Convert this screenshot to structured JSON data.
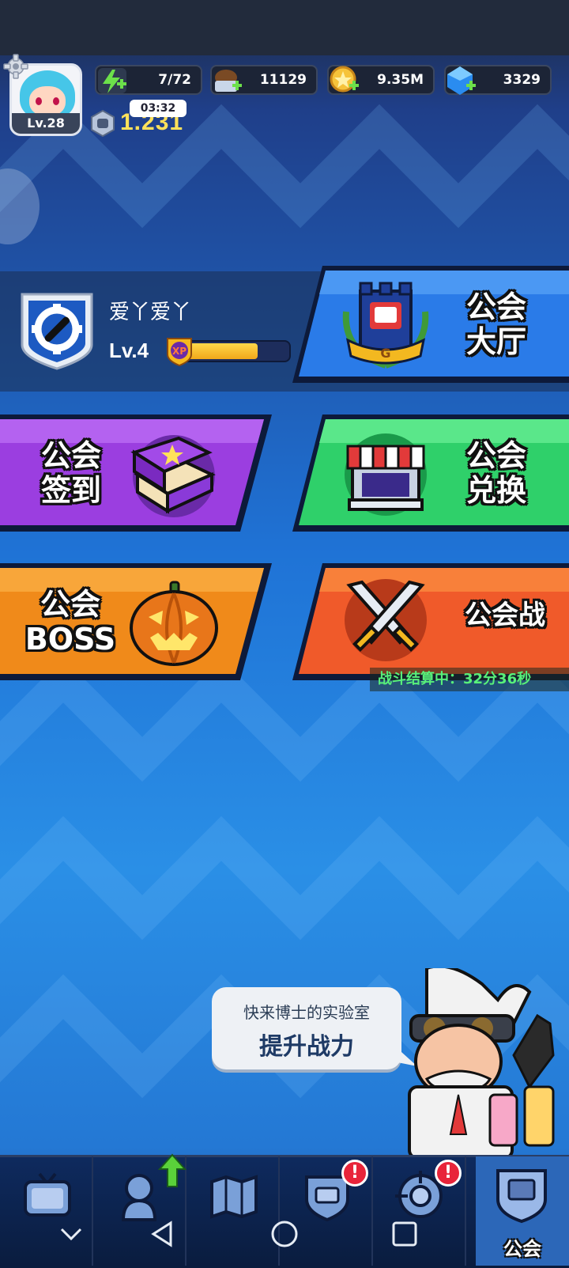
{
  "player": {
    "level_label": "Lv.28",
    "power": "1.231",
    "timer": "03:32"
  },
  "resources": [
    {
      "name": "energy",
      "icon": "lightning-icon",
      "value": "7/72",
      "color": "#5ad13a"
    },
    {
      "name": "exp",
      "icon": "exp-food-icon",
      "value": "11129",
      "color": "#8a5a2a"
    },
    {
      "name": "gold",
      "icon": "gold-coin-icon",
      "value": "9.35M",
      "color": "#f2c232"
    },
    {
      "name": "gem",
      "icon": "blue-gem-icon",
      "value": "3329",
      "color": "#2a8cf0"
    }
  ],
  "guild": {
    "name": "爱丫爱丫",
    "level": "Lv.4",
    "xp_badge": "XP",
    "xp_progress": 0.72
  },
  "cards": {
    "hall": {
      "label": "公会\n大厅",
      "color": "#2a7be8"
    },
    "signin": {
      "label": "公会\n签到",
      "color": "#9b3ee0"
    },
    "exchange": {
      "label": "公会\n兑换",
      "color": "#2fd06a"
    },
    "boss": {
      "label": "公会\nBOSS",
      "color": "#f08a1a"
    },
    "war": {
      "label": "公会战",
      "color": "#f05a2a",
      "status": "战斗结算中：32分36秒"
    }
  },
  "promo": {
    "line1": "快来博士的实验室",
    "line2": "提升战力"
  },
  "tabs": [
    {
      "name": "tv-icon",
      "label": ""
    },
    {
      "name": "hero-icon",
      "label": ""
    },
    {
      "name": "map-icon",
      "label": ""
    },
    {
      "name": "shield-cart-icon",
      "label": ""
    },
    {
      "name": "target-icon",
      "label": ""
    },
    {
      "name": "guild-icon",
      "label": "公会"
    }
  ],
  "badges": {
    "tab4": "!",
    "tab5": "!"
  }
}
